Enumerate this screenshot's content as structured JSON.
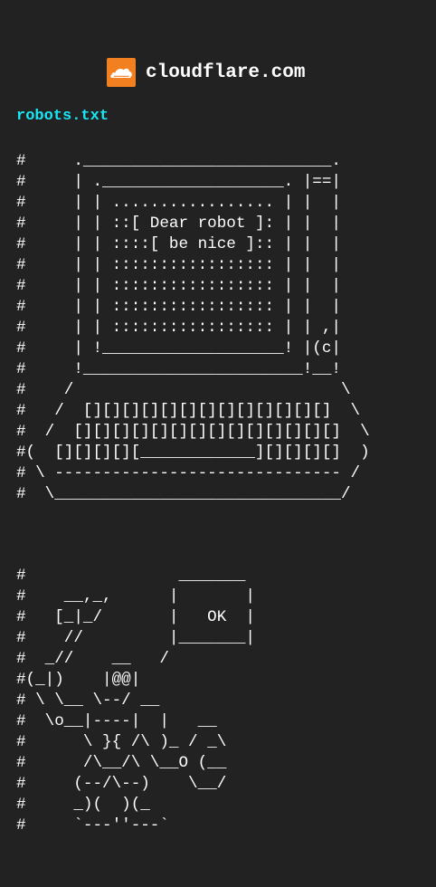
{
  "header": {
    "site_name": "cloudflare.com",
    "logo_icon": "cloudflare-cloud-icon",
    "logo_color": "#f38020"
  },
  "file": {
    "name": "robots.txt",
    "link_color": "#19e6f5"
  },
  "ascii_art": {
    "laptop": "#     .__________________________.\n#     | .___________________. |==|\n#     | | ................. | |  |\n#     | | ::[ Dear robot ]: | |  |\n#     | | ::::[ be nice ]:: | |  |\n#     | | ::::::::::::::::: | |  |\n#     | | ::::::::::::::::: | |  |\n#     | | ::::::::::::::::: | |  |\n#     | | ::::::::::::::::: | | ,|\n#     | !___________________! |(c|\n#     !_______________________!__!\n#    /                            \\\n#   /  [][][][][][][][][][][][][]  \\\n#  /  [][][][][][][][][][][][][][]  \\\n#(  [][][][][____________][][][][]  )\n# \\ ------------------------------ /\n#  \\______________________________/",
    "robot": "#                _______\n#    __,_,      |       |\n#   [_|_/       |   OK  |\n#    //         |_______|\n#  _//    __   /\n#(_|)    |@@|\n# \\ \\__ \\--/ __\n#  \\o__|----|  |   __\n#      \\ }{ /\\ )_ / _\\\n#      /\\__/\\ \\__O (__\n#     (--/\\--)    \\__/\n#     _)(  )(_\n#     `---''---`"
  }
}
